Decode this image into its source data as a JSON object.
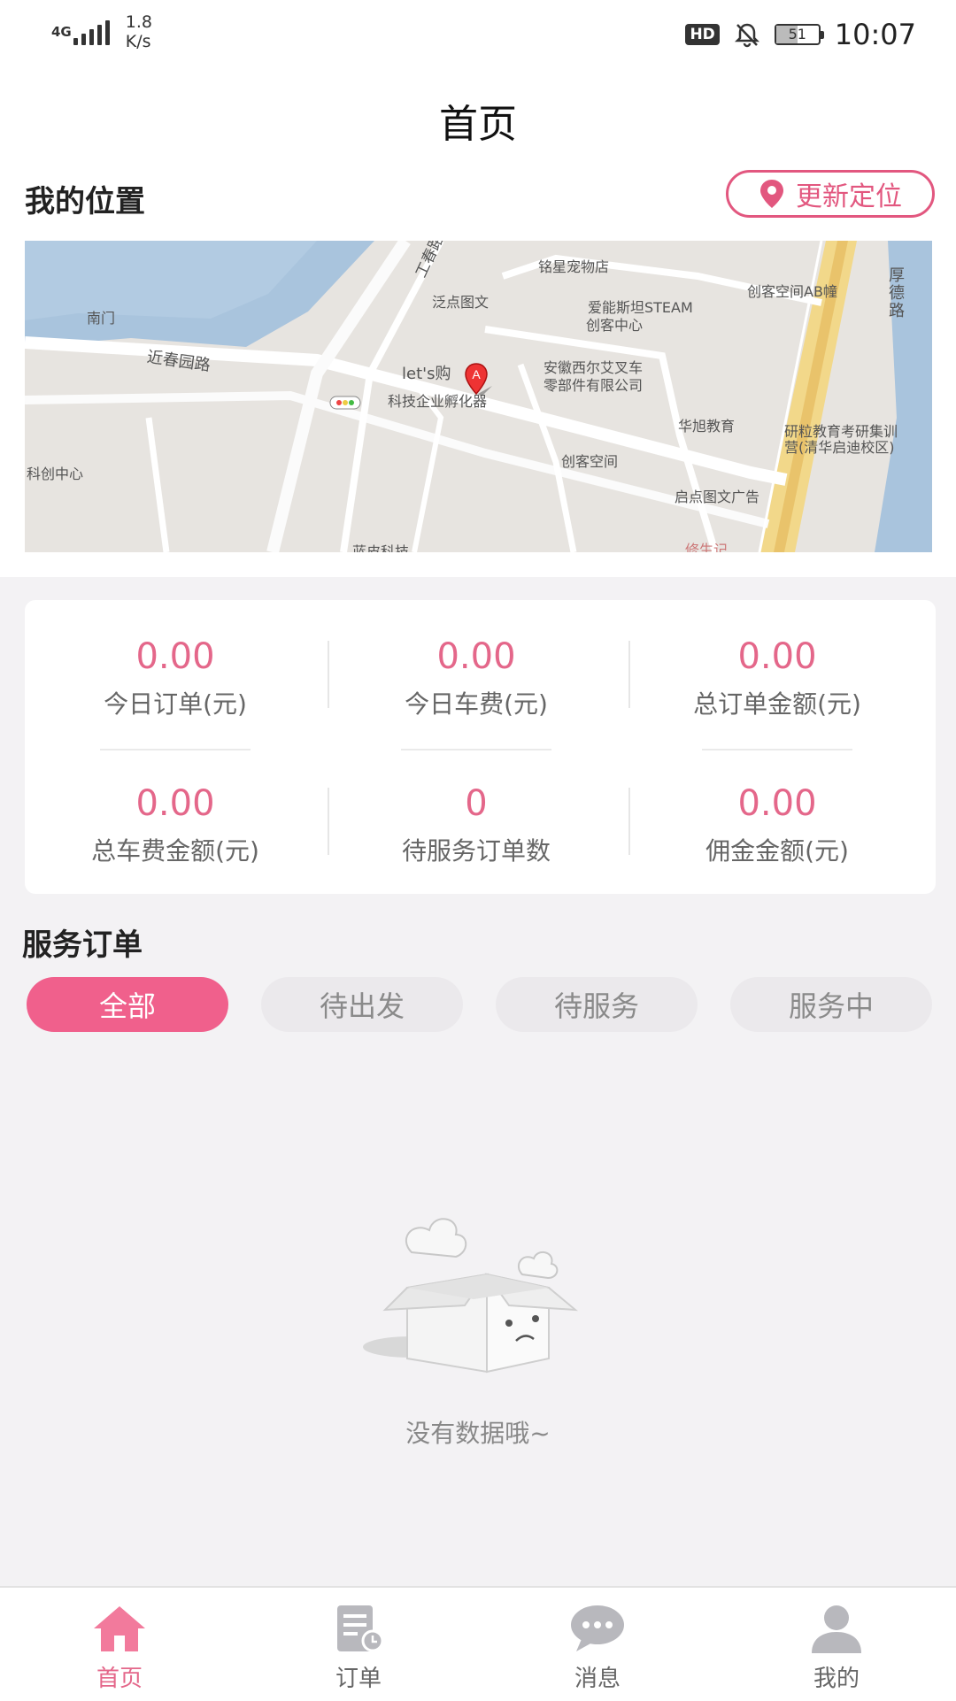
{
  "status_bar": {
    "network": "4G",
    "speed_value": "1.8",
    "speed_unit": "K/s",
    "hd": "HD",
    "battery": "51",
    "time": "10:07"
  },
  "header": {
    "title": "首页"
  },
  "location": {
    "title": "我的位置",
    "update_button": "更新定位",
    "map_labels": {
      "pet": "铭星宠物店",
      "fandian": "泛点图文",
      "steam1": "爱能斯坦STEAM",
      "steam2": "创客中心",
      "ab": "创客空间AB幢",
      "nanmen": "南门",
      "jinchun": "近春园路",
      "lets": "let's购",
      "forklift1": "安徽西尔艾叉车",
      "forklift2": "零部件有限公司",
      "incubator": "科技企业孵化器",
      "huaxu": "华旭教育",
      "yanli1": "研粒教育考研集训",
      "yanli2": "营(清华启迪校区)",
      "kechuang": "科创中心",
      "chuangke": "创客空间",
      "qidian": "启点图文广告",
      "xiusheng": "修生记",
      "keji": "蓝皮科技",
      "houde": "厚德路",
      "road_left": "工春路",
      "marker": "A"
    }
  },
  "stats": [
    {
      "value": "0.00",
      "label": "今日订单(元)"
    },
    {
      "value": "0.00",
      "label": "今日车费(元)"
    },
    {
      "value": "0.00",
      "label": "总订单金额(元)"
    },
    {
      "value": "0.00",
      "label": "总车费金额(元)"
    },
    {
      "value": "0",
      "label": "待服务订单数"
    },
    {
      "value": "0.00",
      "label": "佣金金额(元)"
    }
  ],
  "service_orders": {
    "title": "服务订单",
    "tabs": [
      "全部",
      "待出发",
      "待服务",
      "服务中"
    ],
    "active_tab": "全部",
    "empty_text": "没有数据哦~"
  },
  "bottom_nav": [
    {
      "label": "首页",
      "icon": "home-icon",
      "active": true
    },
    {
      "label": "订单",
      "icon": "order-icon",
      "active": false
    },
    {
      "label": "消息",
      "icon": "message-icon",
      "active": false
    },
    {
      "label": "我的",
      "icon": "user-icon",
      "active": false
    }
  ],
  "colors": {
    "accent": "#f0608c",
    "accent_text": "#e4678a"
  }
}
